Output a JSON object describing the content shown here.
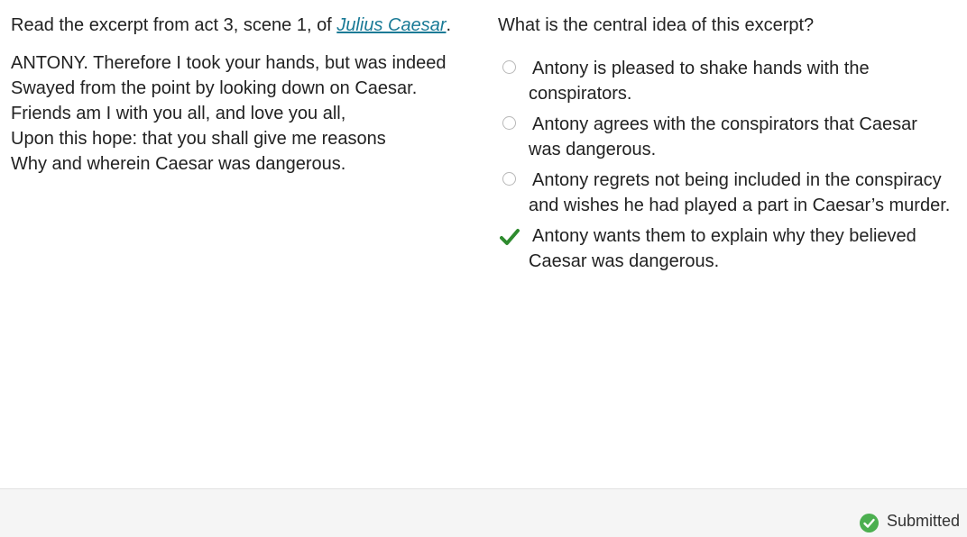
{
  "prompt": {
    "before": "Read the excerpt from act 3, scene 1, of ",
    "link": "Julius Caesar",
    "after": "."
  },
  "excerpt": {
    "lines": [
      "ANTONY. Therefore I took your hands, but was indeed",
      "Swayed from the point by looking down on Caesar.",
      "Friends am I with you all, and love you all,",
      "Upon this hope: that you shall give me reasons",
      "Why and wherein Caesar was dangerous."
    ]
  },
  "question": {
    "text": "What is the central idea of this excerpt?",
    "options": [
      {
        "lines": [
          "Antony is pleased to shake hands with the",
          "conspirators."
        ],
        "selected": false
      },
      {
        "lines": [
          "Antony agrees with the conspirators that Caesar",
          "was dangerous."
        ],
        "selected": false
      },
      {
        "lines": [
          "Antony regrets not being included in the conspiracy",
          "and wishes he had played a part in Caesar’s murder."
        ],
        "selected": false
      },
      {
        "lines": [
          "Antony wants them to explain why they believed",
          "Caesar was dangerous."
        ],
        "selected": true
      }
    ]
  },
  "footer": {
    "status": "Submitted"
  },
  "icons": {
    "selected_option": "checkmark-icon",
    "status": "check-circle-icon"
  },
  "colors": {
    "link": "#1a7a96",
    "check": "#2e8b2e",
    "status_icon": "#4caf50"
  }
}
